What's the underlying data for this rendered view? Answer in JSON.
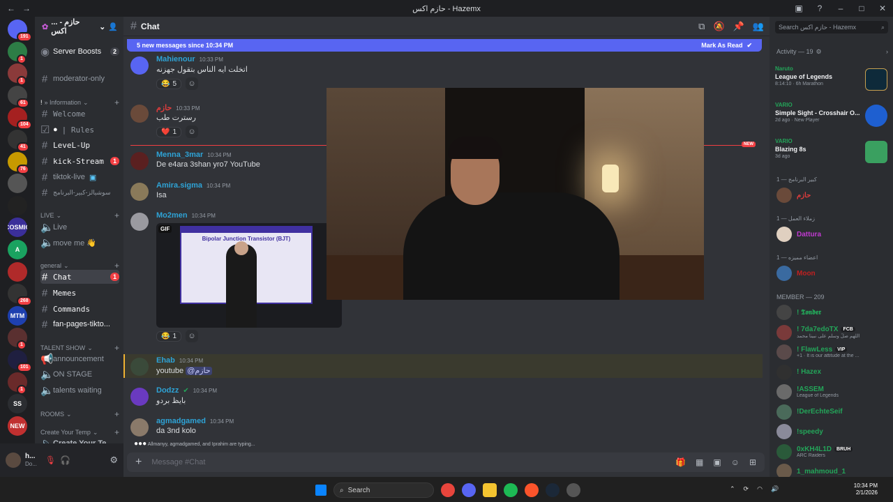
{
  "window": {
    "title": "حازم اكس - Hazemx",
    "back": "←",
    "forward": "→"
  },
  "server_list": [
    {
      "label": "191",
      "icon": "discord-home-icon",
      "color": "#5865f2"
    },
    {
      "label": "1",
      "icon": "server-icon",
      "color": "#2d7d46"
    },
    {
      "label": "1",
      "icon": "server-icon",
      "color": "#8b3a3a"
    },
    {
      "label": "61",
      "icon": "server-icon",
      "color": "#444"
    },
    {
      "label": "104",
      "icon": "server-icon",
      "color": "#a52020"
    },
    {
      "label": "41",
      "icon": "server-icon",
      "color": "#333"
    },
    {
      "label": "76",
      "icon": "server-icon",
      "color": "#c79a00"
    },
    {
      "label": "",
      "icon": "server-icon",
      "color": "#555"
    },
    {
      "label": "",
      "icon": "server-icon",
      "color": "#222"
    },
    {
      "label": "COSMIC",
      "icon": "server-icon",
      "color": "#3b2f9a"
    },
    {
      "label": "A",
      "icon": "server-icon",
      "color": "#1aa260"
    },
    {
      "label": "",
      "icon": "server-icon",
      "color": "#b02a2a"
    },
    {
      "label": "268",
      "icon": "server-icon",
      "color": "#333"
    },
    {
      "label": "MTM",
      "icon": "server-icon",
      "color": "#1e40af"
    },
    {
      "label": "1",
      "icon": "server-icon",
      "color": "#5a3030"
    },
    {
      "label": "101",
      "icon": "server-icon",
      "color": "#1f1f40"
    },
    {
      "label": "1",
      "icon": "server-icon",
      "color": "#6a2a2a"
    },
    {
      "label": "SS",
      "icon": "server-icon",
      "color": "#2b2d31"
    },
    {
      "label": "NEW",
      "icon": "server-icon",
      "color": "#c03030"
    }
  ],
  "guild": {
    "name": "... - حازم اكس",
    "chevron": "⌄"
  },
  "channels": {
    "server_boosts": "Server Boosts",
    "server_boosts_count": "2",
    "moderator_only": "moderator-only",
    "cat_information": "» Information",
    "welcome": "Welcome",
    "rules": "| Rules",
    "level_up": "LeveL-Up",
    "kick_stream": "kick-Stream",
    "kick_stream_count": "1",
    "tiktok_live": "tiktok-live",
    "suwaidalz": "سوشيالز-كبير-البرنامج",
    "cat_live": "LIVE",
    "live": "Live",
    "move_me": "move me 👋",
    "cat_general": "general",
    "chat": "Chat",
    "chat_count": "1",
    "memes": "Memes",
    "commands": "Commands",
    "fan_pages": "fan-pages-tikto...",
    "cat_talent": "TALENT SHOW",
    "announcement": "announcement",
    "on_stage": "ON STAGE",
    "talents_waiting": "talents waiting",
    "cat_rooms": "ROOMS",
    "cat_create_temp": "Create Your Temp",
    "create_your": "Create Your Te..."
  },
  "user_panel": {
    "name": "h...",
    "status": "Do..."
  },
  "header": {
    "channel": "Chat"
  },
  "new_messages_bar": {
    "text": "5 new messages since 10:34 PM",
    "action": "Mark As Read"
  },
  "messages": [
    {
      "author": "Mahienour",
      "time": "10:33 PM",
      "text": "اتخلت ايه الناس بتقول جهزنه",
      "color": "#2ea3d6",
      "reaction_emoji": "😂",
      "reaction_count": "5"
    },
    {
      "author": "حازم",
      "time": "10:33 PM",
      "text": "رسترت طب",
      "color": "#e03c3c",
      "reaction_emoji": "❤️",
      "reaction_count": "1"
    },
    {
      "author": "Menna_3mar",
      "time": "10:34 PM",
      "text": "De e4ara 3shan yro7 YouTube",
      "color": "#2ea3d6"
    },
    {
      "author": "Amira.sigma",
      "time": "10:34 PM",
      "text": "Isa",
      "color": "#2ea3d6"
    },
    {
      "author": "Mo2men",
      "time": "10:34 PM",
      "text": "",
      "color": "#2ea3d6",
      "gif_label": "GIF",
      "gif_title": "Bipolar Junction Transistor (BJT)",
      "reaction_emoji": "😂",
      "reaction_count": "1"
    },
    {
      "author": "Ehab",
      "time": "10:34 PM",
      "text": "youtube",
      "mention": "@حازم",
      "color": "#2ea3d6"
    },
    {
      "author": "Dodzz",
      "time": "10:34 PM",
      "text": "بايظ بردو",
      "color": "#2ea3d6"
    },
    {
      "author": "agmadgamed",
      "time": "10:34 PM",
      "text": "da 3nd kolo",
      "color": "#2ea3d6"
    }
  ],
  "new_tag": "NEW",
  "typing": "Allmanyy, agmadgamed, and Iprahim are typing...",
  "composer": {
    "placeholder": "Message #Chat"
  },
  "member_search": {
    "placeholder": "Search حازم اكس - Hazemx"
  },
  "activity": {
    "header": "Activity — 19",
    "items": [
      {
        "user": "Naruto",
        "game": "League of Legends",
        "detail": "8:14:10 · 6h Marathon"
      },
      {
        "user": "VARIO",
        "game": "Simple Sight - Crosshair O...",
        "detail": "2d ago · New Player"
      },
      {
        "user": "VARIO",
        "game": "Blazing 8s",
        "detail": "3d ago"
      }
    ]
  },
  "member_sections": [
    {
      "title": "كبير البرنامج — 1",
      "member": "حازم",
      "color": "#e03c3c"
    },
    {
      "title": "زملاء العمل — 1",
      "member": "Dattura",
      "color": "#c03ad0"
    },
    {
      "title": "اعضاء مميزه — 1",
      "member": "Moon",
      "color": "#c02020"
    }
  ],
  "member_header": "MEMBER — 209",
  "members": [
    {
      "name": "! 𝕿𝖔𝖓𝖉𝖊𝖗",
      "sub": "",
      "color": "#23a559"
    },
    {
      "name": "! 7da7edoTX",
      "tag": "FCB",
      "sub": "اللهم صلِّ وسلم على نبينا محمد",
      "color": "#23a559"
    },
    {
      "name": "! FlawLess",
      "tag": "VIP",
      "sub": "+1 · It is our attitude at the ...",
      "color": "#23a559"
    },
    {
      "name": "! Hazex",
      "sub": "",
      "color": "#23a559"
    },
    {
      "name": "!ASSEM",
      "sub": "League of Legends",
      "color": "#23a559"
    },
    {
      "name": "!DerEchteSeif",
      "sub": "",
      "color": "#23a559"
    },
    {
      "name": "!speedy",
      "sub": "",
      "color": "#23a559"
    },
    {
      "name": "0xKH4L1D",
      "tag": "BRUH",
      "sub": "ARC Raiders",
      "color": "#23a559"
    },
    {
      "name": "1_mahmoud_1",
      "sub": "",
      "color": "#23a559"
    }
  ],
  "taskbar": {
    "search": "Search",
    "time": "10:34 PM",
    "date": "2/1/2026"
  }
}
